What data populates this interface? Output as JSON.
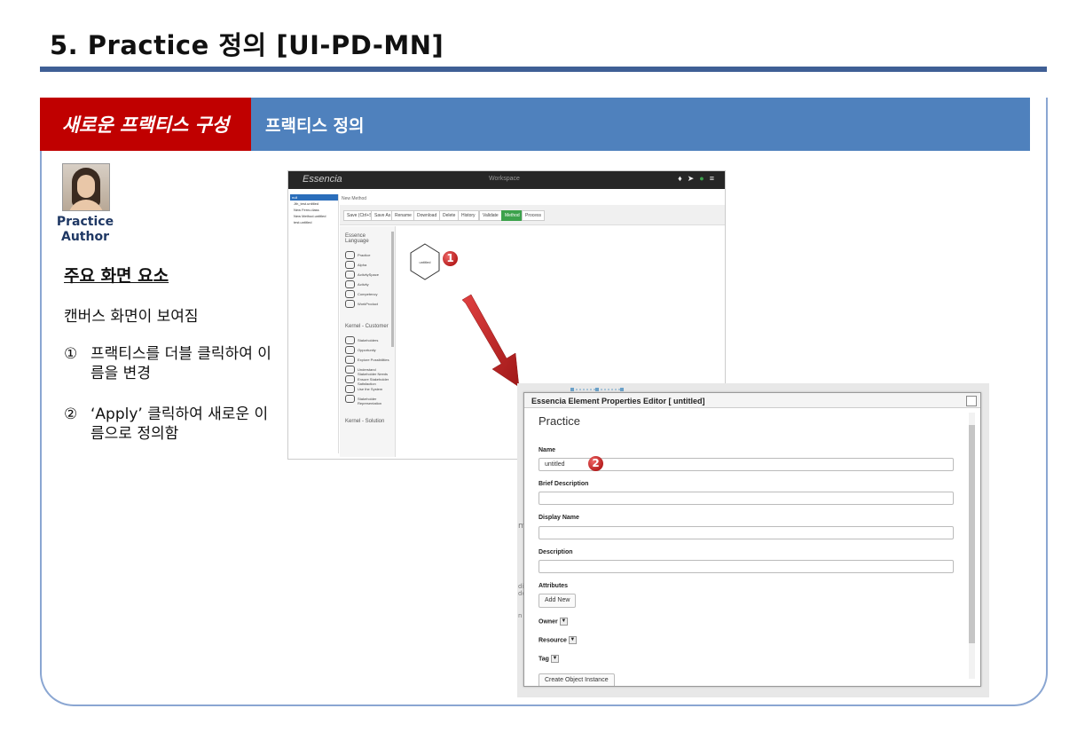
{
  "slide": {
    "title": "5. Practice 정의 [UI-PD-MN]",
    "header_left": "새로운 프랙티스 구성",
    "header_right": "프랙티스 정의",
    "role": "Practice Author",
    "section_title": "주요 화면 요소",
    "description": "캔버스 화면이 보여짐",
    "steps": [
      {
        "num": "①",
        "text": "프랙티스를 더블 클릭하여 이름을 변경"
      },
      {
        "num": "②",
        "text": "‘Apply’ 클릭하여 새로운 이름으로 정의함"
      }
    ]
  },
  "app": {
    "logo": "Essencia",
    "workspace": "Workspace",
    "icons": [
      "bell-icon",
      "send-icon",
      "user-icon",
      "menu-icon"
    ],
    "tree": [
      "null",
      "Jth_test.untitled",
      "New Fernu.ilass",
      "New Method.untitled",
      "test.untitled"
    ],
    "breadcrumb": "New Method",
    "toolbar": [
      "Save (Ctrl+S)",
      "Save As",
      "Rename",
      "Download",
      "Delete",
      "History",
      "Validate",
      "Method",
      "Process"
    ],
    "active_tool": "Method",
    "palette_sections": [
      {
        "title": "Essence Language",
        "items": [
          "Practice",
          "Alpha",
          "ActivitySpace",
          "Activity",
          "Competency",
          "WorkProduct"
        ]
      },
      {
        "title": "Kernel - Customer",
        "items": [
          "Stakeholders",
          "Opportunity",
          "Explore Possibilities",
          "Understand Stakeholder Needs",
          "Ensure Stakeholder Satisfaction",
          "Use the System",
          "Stakeholder Representation"
        ]
      },
      {
        "title": "Kernel - Solution",
        "items": []
      }
    ],
    "canvas_node_label": "untitled",
    "badge": "1"
  },
  "editor": {
    "title": "Essencia Element Properties Editor [ untitled]",
    "heading": "Practice",
    "badge": "2",
    "fields": {
      "name_label": "Name",
      "name_value": "untitled",
      "brief_label": "Brief Description",
      "display_label": "Display Name",
      "desc_label": "Description",
      "attributes_label": "Attributes",
      "add_new": "Add New",
      "owner_label": "Owner",
      "resource_label": "Resource",
      "tag_label": "Tag",
      "create_instance": "Create Object Instance"
    }
  },
  "colors": {
    "header_red": "#c00000",
    "header_blue": "#4f81bd",
    "accent_green": "#3ca24c",
    "title_rule": "#3f5f95"
  }
}
